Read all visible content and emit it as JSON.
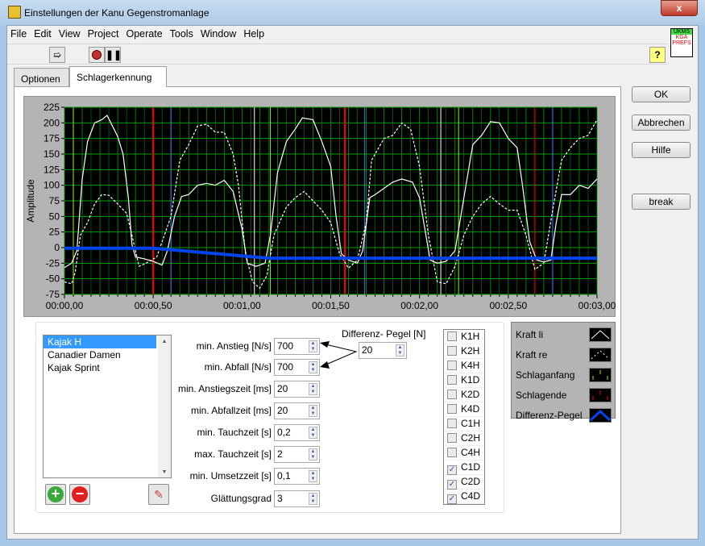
{
  "window": {
    "title": "Einstellungen der Kanu Gegenstromanlage",
    "close": "x"
  },
  "menu": [
    "File",
    "Edit",
    "View",
    "Project",
    "Operate",
    "Tools",
    "Window",
    "Help"
  ],
  "toolbar": {
    "run": "run-arrow-icon",
    "abort": "stop-icon",
    "pause": "pause-icon",
    "help": "?"
  },
  "logo": {
    "text1": "UKMS",
    "text2": "KGA PREFS"
  },
  "tabs": [
    {
      "label": "Optionen",
      "active": false
    },
    {
      "label": "Schlagerkennung",
      "active": true
    }
  ],
  "buttons": {
    "ok": "OK",
    "cancel": "Abbrechen",
    "help": "Hilfe",
    "break": "break"
  },
  "chart_data": {
    "type": "line",
    "ylabel": "Amplitude",
    "xlim": [
      0,
      3
    ],
    "ylim": [
      -75,
      225
    ],
    "yticks": [
      "225",
      "200",
      "175",
      "150",
      "125",
      "100",
      "75",
      "50",
      "25",
      "0",
      "-25",
      "-50",
      "-75"
    ],
    "xticks": [
      "00:00,00",
      "00:00,50",
      "00:01,00",
      "00:01,50",
      "00:02,00",
      "00:02,50",
      "00:03,00"
    ],
    "background": "#000000",
    "grid_color": "#00a000",
    "grid": true,
    "series": [
      {
        "name": "Kraft li",
        "style": "solid",
        "color": "#ffffff",
        "points": [
          [
            0,
            -32
          ],
          [
            0.04,
            -25
          ],
          [
            0.07,
            -5
          ],
          [
            0.1,
            110
          ],
          [
            0.13,
            170
          ],
          [
            0.17,
            200
          ],
          [
            0.21,
            205
          ],
          [
            0.24,
            212
          ],
          [
            0.27,
            195
          ],
          [
            0.3,
            178
          ],
          [
            0.33,
            150
          ],
          [
            0.36,
            80
          ],
          [
            0.38,
            5
          ],
          [
            0.4,
            -15
          ],
          [
            0.45,
            -18
          ],
          [
            0.5,
            -22
          ],
          [
            0.55,
            -28
          ],
          [
            0.58,
            -5
          ],
          [
            0.62,
            50
          ],
          [
            0.66,
            82
          ],
          [
            0.7,
            85
          ],
          [
            0.75,
            100
          ],
          [
            0.8,
            103
          ],
          [
            0.85,
            100
          ],
          [
            0.9,
            108
          ],
          [
            0.95,
            90
          ],
          [
            1.0,
            30
          ],
          [
            1.03,
            -25
          ],
          [
            1.08,
            -30
          ],
          [
            1.13,
            -25
          ],
          [
            1.16,
            20
          ],
          [
            1.2,
            120
          ],
          [
            1.25,
            170
          ],
          [
            1.3,
            190
          ],
          [
            1.34,
            208
          ],
          [
            1.4,
            205
          ],
          [
            1.45,
            170
          ],
          [
            1.5,
            130
          ],
          [
            1.53,
            50
          ],
          [
            1.56,
            -10
          ],
          [
            1.6,
            -20
          ],
          [
            1.65,
            -25
          ],
          [
            1.68,
            -5
          ],
          [
            1.72,
            80
          ],
          [
            1.75,
            85
          ],
          [
            1.8,
            95
          ],
          [
            1.85,
            105
          ],
          [
            1.9,
            110
          ],
          [
            1.96,
            105
          ],
          [
            2.0,
            80
          ],
          [
            2.03,
            30
          ],
          [
            2.06,
            -20
          ],
          [
            2.1,
            -25
          ],
          [
            2.15,
            -22
          ],
          [
            2.2,
            -5
          ],
          [
            2.25,
            80
          ],
          [
            2.3,
            165
          ],
          [
            2.35,
            180
          ],
          [
            2.4,
            202
          ],
          [
            2.45,
            200
          ],
          [
            2.5,
            175
          ],
          [
            2.55,
            160
          ],
          [
            2.58,
            100
          ],
          [
            2.62,
            10
          ],
          [
            2.66,
            -20
          ],
          [
            2.7,
            -23
          ],
          [
            2.74,
            -20
          ],
          [
            2.77,
            40
          ],
          [
            2.8,
            85
          ],
          [
            2.85,
            85
          ],
          [
            2.9,
            100
          ],
          [
            2.95,
            95
          ],
          [
            3.0,
            110
          ]
        ]
      },
      {
        "name": "Kraft re",
        "style": "dashed",
        "color": "#ffffff",
        "points": [
          [
            0,
            -55
          ],
          [
            0.04,
            -58
          ],
          [
            0.06,
            -40
          ],
          [
            0.09,
            20
          ],
          [
            0.13,
            40
          ],
          [
            0.17,
            70
          ],
          [
            0.21,
            85
          ],
          [
            0.25,
            84
          ],
          [
            0.3,
            70
          ],
          [
            0.35,
            55
          ],
          [
            0.38,
            20
          ],
          [
            0.42,
            -30
          ],
          [
            0.46,
            -25
          ],
          [
            0.52,
            -15
          ],
          [
            0.6,
            50
          ],
          [
            0.65,
            140
          ],
          [
            0.7,
            165
          ],
          [
            0.75,
            195
          ],
          [
            0.8,
            198
          ],
          [
            0.85,
            185
          ],
          [
            0.9,
            185
          ],
          [
            0.95,
            150
          ],
          [
            0.98,
            100
          ],
          [
            1.02,
            -10
          ],
          [
            1.06,
            -55
          ],
          [
            1.1,
            -65
          ],
          [
            1.14,
            -45
          ],
          [
            1.18,
            20
          ],
          [
            1.25,
            65
          ],
          [
            1.3,
            80
          ],
          [
            1.35,
            90
          ],
          [
            1.4,
            75
          ],
          [
            1.45,
            60
          ],
          [
            1.5,
            40
          ],
          [
            1.55,
            -10
          ],
          [
            1.6,
            -33
          ],
          [
            1.65,
            -20
          ],
          [
            1.7,
            40
          ],
          [
            1.73,
            140
          ],
          [
            1.8,
            175
          ],
          [
            1.85,
            180
          ],
          [
            1.9,
            200
          ],
          [
            1.95,
            190
          ],
          [
            2.0,
            130
          ],
          [
            2.05,
            20
          ],
          [
            2.1,
            -55
          ],
          [
            2.15,
            -58
          ],
          [
            2.2,
            -30
          ],
          [
            2.25,
            20
          ],
          [
            2.3,
            50
          ],
          [
            2.35,
            70
          ],
          [
            2.4,
            82
          ],
          [
            2.45,
            70
          ],
          [
            2.5,
            60
          ],
          [
            2.55,
            60
          ],
          [
            2.6,
            20
          ],
          [
            2.65,
            -35
          ],
          [
            2.7,
            -25
          ],
          [
            2.75,
            60
          ],
          [
            2.8,
            140
          ],
          [
            2.85,
            160
          ],
          [
            2.9,
            175
          ],
          [
            2.95,
            180
          ],
          [
            3.0,
            205
          ]
        ]
      },
      {
        "name": "Differenz-Pegel",
        "style": "thick",
        "color": "#0044ee",
        "points": [
          [
            0,
            -1
          ],
          [
            0.5,
            -1
          ],
          [
            1.15,
            -17
          ],
          [
            3.0,
            -17
          ]
        ]
      }
    ],
    "markers": [
      {
        "name": "Schlaganfang",
        "color": "#80ff00",
        "x": [
          0.05,
          1.16,
          2.22
        ]
      },
      {
        "name": "Schlagende",
        "color": "#ff0000",
        "x": [
          0.5,
          1.58,
          2.65
        ]
      },
      {
        "name": "",
        "color": "#3080ff",
        "x": [
          0.6,
          1.69,
          2.75
        ]
      },
      {
        "name": "",
        "color": "#ffffff",
        "x": [
          1.07,
          2.12
        ]
      }
    ]
  },
  "profiles": {
    "items": [
      "Kajak H",
      "Canadier Damen",
      "Kajak Sprint"
    ],
    "selected": "Kajak H"
  },
  "params": [
    {
      "label": "min. Anstieg [N/s]",
      "value": "700"
    },
    {
      "label": "min. Abfall [N/s]",
      "value": "700"
    },
    {
      "label": "min. Anstiegszeit [ms]",
      "value": "20"
    },
    {
      "label": "min. Abfallzeit [ms]",
      "value": "20"
    },
    {
      "label": "min. Tauchzeit [s]",
      "value": "0,2"
    },
    {
      "label": "max. Tauchzeit [s]",
      "value": "2"
    },
    {
      "label": "min. Umsetzzeit [s]",
      "value": "0,1"
    },
    {
      "label": "Glättungsgrad",
      "value": "3"
    }
  ],
  "diff_pegel": {
    "label": "Differenz- Pegel [N]",
    "value": "20"
  },
  "checks": [
    {
      "label": "K1H",
      "checked": false
    },
    {
      "label": "K2H",
      "checked": false
    },
    {
      "label": "K4H",
      "checked": false
    },
    {
      "label": "K1D",
      "checked": false
    },
    {
      "label": "K2D",
      "checked": false
    },
    {
      "label": "K4D",
      "checked": false
    },
    {
      "label": "C1H",
      "checked": false
    },
    {
      "label": "C2H",
      "checked": false
    },
    {
      "label": "C4H",
      "checked": false
    },
    {
      "label": "C1D",
      "checked": true
    },
    {
      "label": "C2D",
      "checked": true
    },
    {
      "label": "C4D",
      "checked": true
    }
  ],
  "legend": [
    "Kraft li",
    "Kraft re",
    "Schlaganfang",
    "Schlagende",
    "Differenz-Pegel"
  ]
}
